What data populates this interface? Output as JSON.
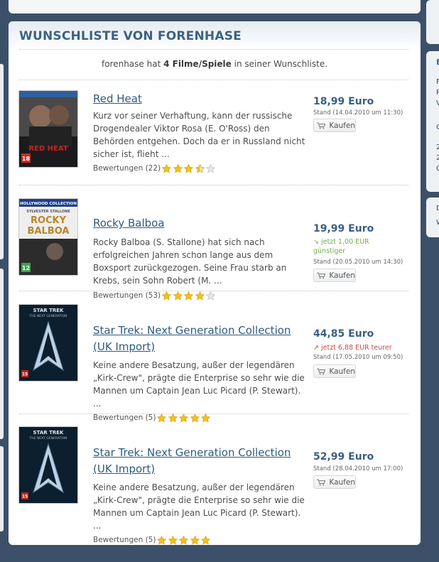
{
  "panel": {
    "title": "WUNSCHLISTE VON FORENHASE",
    "summary_user": "forenhase",
    "summary_pre": " hat ",
    "summary_count": "4 Filme/Spiele",
    "summary_post": " in seiner Wunschliste."
  },
  "items": [
    {
      "title": "Red Heat",
      "description": "Kurz vor seiner Verhaftung, kann der russische Drogendealer Viktor Rosa (E. O'Ross) den Behörden entgehen. Doch da er in Russland nicht sicher ist, flieht ...",
      "rating_label": "Bewertungen (22)",
      "rating": 3.5,
      "price": "18,99 Euro",
      "note": "",
      "stand": "Stand (14.04.2010 um 11:30)",
      "buy_label": "Kaufen",
      "cover_icon": "red-heat-cover"
    },
    {
      "title": "Rocky Balboa",
      "description": "Rocky Balboa (S. Stallone) hat sich nach erfolgreichen Jahren schon lange aus dem Boxsport zurückgezogen. Seine Frau starb an Krebs, sein Sohn Robert (M. ...",
      "rating_label": "Bewertungen (53)",
      "rating": 4,
      "price": "19,99 Euro",
      "note": "↘ jetzt 1,00 EUR günstiger",
      "stand": "Stand (20.05.2010 um 14:30)",
      "buy_label": "Kaufen",
      "cover_icon": "rocky-balboa-cover"
    },
    {
      "title": "Star Trek: Next Generation Collection (UK Import)",
      "description": "Keine andere Besatzung, außer der legendären „Kirk-Crew\", prägte die Enterprise so sehr wie die Mannen um Captain Jean Luc Picard (P. Stewart). ...",
      "rating_label": "Bewertungen (5)",
      "rating": 5,
      "price": "44,85 Euro",
      "note": "↗ jetzt 6,88 EUR teurer",
      "stand": "Stand (17.05.2010 um 09:50)",
      "buy_label": "Kaufen",
      "cover_icon": "star-trek-cover"
    },
    {
      "title": "Star Trek: Next Generation Collection (UK Import)",
      "description": "Keine andere Besatzung, außer der legendären „Kirk-Crew\", prägte die Enterprise so sehr wie die Mannen um Captain Jean Luc Picard (P. Stewart). ...",
      "rating_label": "Bewertungen (5)",
      "rating": 5,
      "price": "52,99 Euro",
      "note": "",
      "stand": "Stand (28.04.2010 um 17:00)",
      "buy_label": "Kaufen",
      "cover_icon": "star-trek-cover"
    }
  ],
  "cover_text": {
    "redheat_brand": "RED HEAT",
    "redheat_age": "18",
    "rocky_collection": "HOLLYWOOD COLLECTION",
    "rocky_actor": "SYLVESTER STALLONE",
    "rocky_title_1": "ROCKY",
    "rocky_title_2": "BALBOA",
    "rocky_age": "12",
    "startrek_title": "STAR TREK",
    "startrek_sub": "THE NEXT GENERATION",
    "startrek_age": "15"
  },
  "sidebar_right": {
    "fragments": [
      "E",
      "F",
      "R",
      "V",
      "O",
      "2",
      "2",
      "C",
      "D",
      "W"
    ]
  },
  "colors": {
    "accent": "#3d6283",
    "price": "#3a5f83",
    "background": "#3c5069",
    "star": "#f2c21b",
    "cheaper": "#6fb04a",
    "pricier": "#c84a4a"
  }
}
